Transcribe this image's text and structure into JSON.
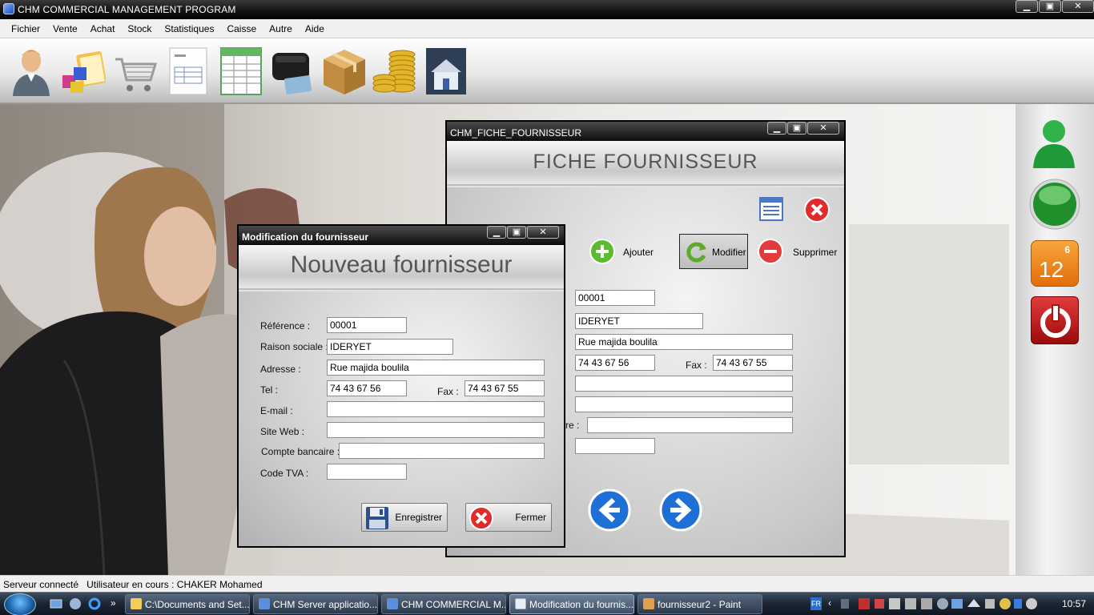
{
  "app": {
    "title": "CHM COMMERCIAL MANAGEMENT PROGRAM",
    "win_min": "▁",
    "win_max": "▣",
    "win_close": "✕"
  },
  "menu": [
    "Fichier",
    "Vente",
    "Achat",
    "Stock",
    "Statistiques",
    "Caisse",
    "Autre",
    "Aide"
  ],
  "toolbar_icons": [
    "user-icon",
    "cubes-folder-icon",
    "shopping-cart-icon",
    "invoice-document-icon",
    "spreadsheet-icon",
    "wallet-icon",
    "cardboard-box-icon",
    "coins-icon",
    "house-icon"
  ],
  "side_panel": {
    "calendar_month": "6",
    "calendar_day": "12"
  },
  "fiche": {
    "title": "CHM_FICHE_FOURNISSEUR",
    "header": "FICHE FOURNISSEUR",
    "add_label": "Ajouter",
    "edit_label": "Modifier",
    "delete_label": "Supprimer",
    "reference": "00001",
    "raison_sociale": "IDERYET",
    "adresse": "Rue majida boulila",
    "tel": "74 43 67 56",
    "fax_label": "Fax :",
    "fax": "74 43 67 55",
    "email": "",
    "site_web": "",
    "compte_label_partial": "re :",
    "compte": "",
    "tva": ""
  },
  "modif": {
    "title": "Modification du fournisseur",
    "header": "Nouveau fournisseur",
    "labels": {
      "reference": "Référence :",
      "raison_sociale": "Raison sociale :",
      "adresse": "Adresse :",
      "tel": "Tel :",
      "fax": "Fax :",
      "email": "E-mail :",
      "site_web": "Site Web :",
      "compte": "Compte bancaire :",
      "tva": "Code TVA :"
    },
    "values": {
      "reference": "00001",
      "raison_sociale": "IDERYET",
      "adresse": "Rue majida boulila",
      "tel": "74 43 67 56",
      "fax": "74 43 67 55",
      "email": "",
      "site_web": "",
      "compte": "",
      "tva": ""
    },
    "save_label": "Enregistrer",
    "close_label": "Fermer"
  },
  "status": {
    "connection": "Serveur connecté",
    "user": "Utilisateur en cours : CHAKER Mohamed"
  },
  "taskbar": {
    "tasks": [
      "C:\\Documents and Set...",
      "CHM Server applicatio...",
      "CHM COMMERCIAL M...",
      "Modification du fournis...",
      "fournisseur2 - Paint"
    ],
    "lang": "FR",
    "clock": "10:57"
  }
}
